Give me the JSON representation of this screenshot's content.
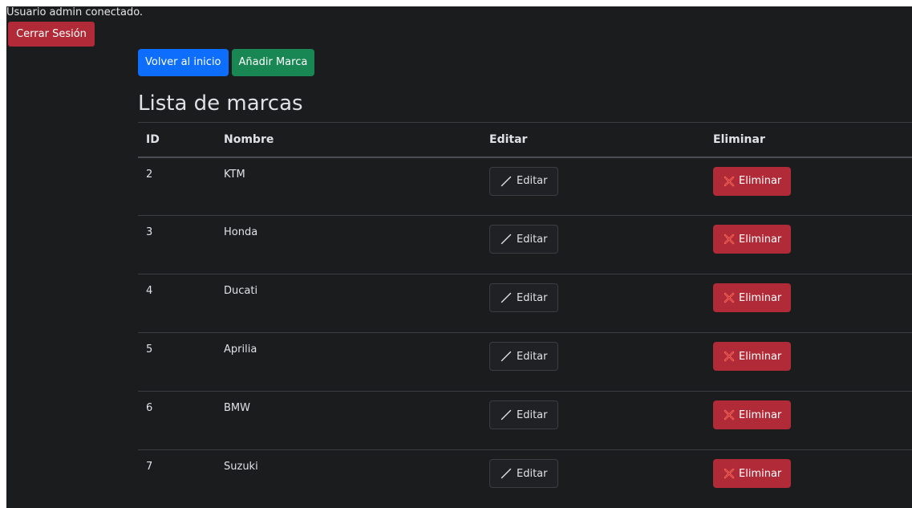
{
  "session": {
    "status_text": "Usuario admin conectado.",
    "logout_label": "Cerrar Sesión"
  },
  "actions": {
    "back_label": "Volver al inicio",
    "add_label": "Añadir Marca"
  },
  "page": {
    "title": "Lista de marcas"
  },
  "table": {
    "headers": [
      "ID",
      "Nombre",
      "Editar",
      "Eliminar"
    ],
    "rows": [
      {
        "id": "2",
        "name": "KTM",
        "edit_label": "Editar",
        "delete_label": "Eliminar"
      },
      {
        "id": "3",
        "name": "Honda",
        "edit_label": "Editar",
        "delete_label": "Eliminar"
      },
      {
        "id": "4",
        "name": "Ducati",
        "edit_label": "Editar",
        "delete_label": "Eliminar"
      },
      {
        "id": "5",
        "name": "Aprilia",
        "edit_label": "Editar",
        "delete_label": "Eliminar"
      },
      {
        "id": "6",
        "name": "BMW",
        "edit_label": "Editar",
        "delete_label": "Eliminar"
      },
      {
        "id": "7",
        "name": "Suzuki",
        "edit_label": "Editar",
        "delete_label": "Eliminar"
      }
    ]
  },
  "icons": {
    "edit": "pencil-icon",
    "delete": "x-icon"
  },
  "colors": {
    "background": "#1b1c1e",
    "danger": "#b02a37",
    "primary": "#0d6efd",
    "success": "#198754"
  }
}
